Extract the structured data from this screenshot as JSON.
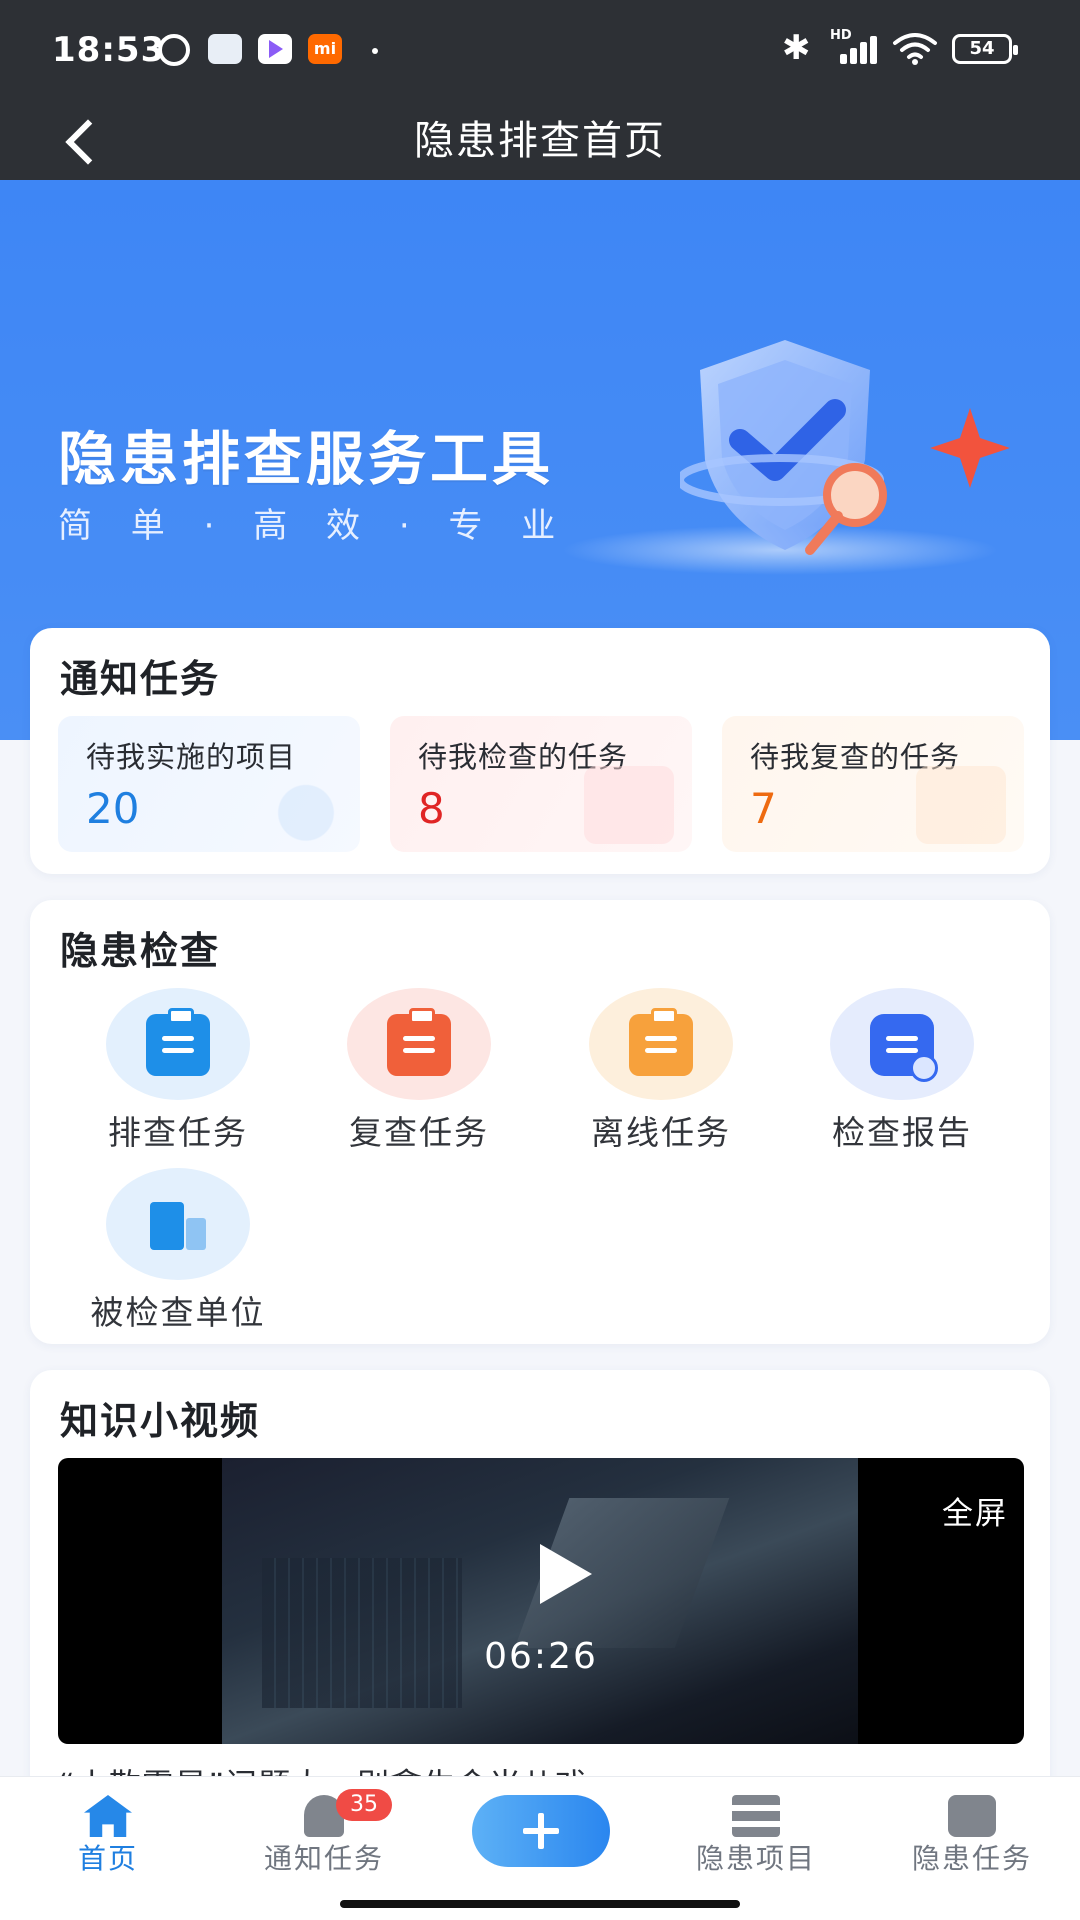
{
  "status_bar": {
    "time": "18:53",
    "network_label": "HD",
    "battery": "54",
    "app_icon_mi": "mi",
    "icons": [
      "alarm-icon",
      "app-icon",
      "play-store-icon",
      "mi-icon",
      "bluetooth-icon",
      "signal-icon",
      "wifi-icon",
      "battery-icon"
    ]
  },
  "header": {
    "title": "隐患排查首页",
    "back_icon": "chevron-left-icon"
  },
  "banner": {
    "heading": "隐患排查服务工具",
    "subheading": "简 单 · 高 效 · 专 业",
    "colors": {
      "background": "#3e86f5"
    }
  },
  "notify_tasks": {
    "title": "通知任务",
    "items": [
      {
        "label": "待我实施的项目",
        "value": "20",
        "color": "#1f7fe0"
      },
      {
        "label": "待我检查的任务",
        "value": "8",
        "color": "#e02525"
      },
      {
        "label": "待我复查的任务",
        "value": "7",
        "color": "#ee6a10"
      }
    ]
  },
  "hazard_check": {
    "title": "隐患检查",
    "items": [
      {
        "label": "排查任务",
        "icon": "inspection-clipboard-icon"
      },
      {
        "label": "复查任务",
        "icon": "recheck-clipboard-icon"
      },
      {
        "label": "离线任务",
        "icon": "offline-clipboard-icon"
      },
      {
        "label": "检查报告",
        "icon": "report-icon"
      },
      {
        "label": "被检查单位",
        "icon": "building-icon"
      }
    ]
  },
  "videos": {
    "title": "知识小视频",
    "fullscreen_label": "全屏",
    "duration": "06:26",
    "caption": "“小散零星”问题大，别拿生命当儿戏"
  },
  "tabbar": {
    "items": [
      {
        "label": "首页",
        "icon": "home-icon",
        "active": true
      },
      {
        "label": "通知任务",
        "icon": "bell-icon",
        "badge": "35"
      },
      {
        "label": "",
        "icon": "plus-icon"
      },
      {
        "label": "隐患项目",
        "icon": "list-icon"
      },
      {
        "label": "隐患任务",
        "icon": "task-clipboard-icon"
      }
    ],
    "colors": {
      "active": "#1f7fe0",
      "inactive": "#707680",
      "badge": "#f04b45"
    }
  }
}
